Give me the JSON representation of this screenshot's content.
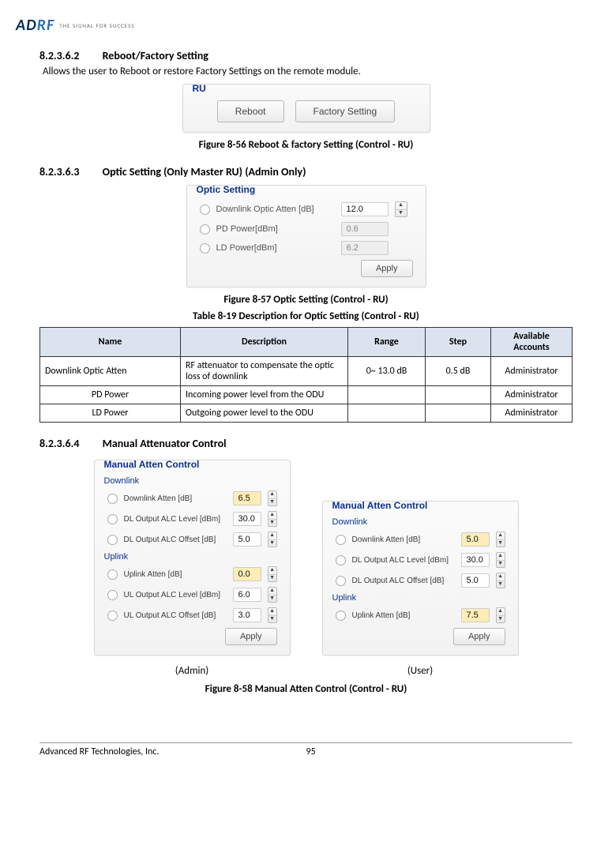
{
  "logo": {
    "brand": "ADRF",
    "tagline": "THE SIGNAL FOR SUCCESS"
  },
  "sections": {
    "reboot": {
      "num": "8.2.3.6.2",
      "title": "Reboot/Factory Setting",
      "body": "Allows the user to Reboot or restore Factory Settings on the remote module.",
      "panel_title": "RU",
      "btn_reboot": "Reboot",
      "btn_factory": "Factory Setting",
      "caption": "Figure 8-56   Reboot & factory Setting (Control - RU)"
    },
    "optic": {
      "num": "8.2.3.6.3",
      "title": "Optic Setting (Only Master RU) (Admin Only)",
      "panel_title": "Optic Setting",
      "rows": {
        "dl_label": "Downlink Optic Atten [dB]",
        "dl_val": "12.0",
        "pd_label": "PD Power[dBm]",
        "pd_val": "0.6",
        "ld_label": "LD Power[dBm]",
        "ld_val": "6.2"
      },
      "btn_apply": "Apply",
      "caption": "Figure 8-57   Optic Setting (Control - RU)"
    },
    "table": {
      "caption": "Table 8-19    Description for Optic Setting (Control - RU)",
      "headers": [
        "Name",
        "Description",
        "Range",
        "Step",
        "Available Accounts"
      ],
      "rows": [
        {
          "name": "Downlink Optic Atten",
          "desc": "RF attenuator to compensate the optic loss of downlink",
          "range": "0~ 13.0 dB",
          "step": "0.5 dB",
          "acct": "Administrator"
        },
        {
          "name": "PD Power",
          "desc": "Incoming power level from the ODU",
          "range": "",
          "step": "",
          "acct": "Administrator"
        },
        {
          "name": "LD Power",
          "desc": "Outgoing power level to the ODU",
          "range": "",
          "step": "",
          "acct": "Administrator"
        }
      ]
    },
    "manual": {
      "num": "8.2.3.6.4",
      "title": "Manual Attenuator Control",
      "panel_title": "Manual Atten Control",
      "downlink_hdr": "Downlink",
      "uplink_hdr": "Uplink",
      "admin": {
        "rows": [
          {
            "label": "Downlink Atten [dB]",
            "val": "6.5",
            "accent": true
          },
          {
            "label": "DL Output ALC Level [dBm]",
            "val": "30.0"
          },
          {
            "label": "DL Output ALC Offset [dB]",
            "val": "5.0"
          }
        ],
        "uplink_rows": [
          {
            "label": "Uplink Atten [dB]",
            "val": "0.0",
            "accent": true
          },
          {
            "label": "UL Output ALC Level [dBm]",
            "val": "6.0"
          },
          {
            "label": "UL Output ALC Offset [dB]",
            "val": "3.0"
          }
        ]
      },
      "user": {
        "rows": [
          {
            "label": "Downlink Atten [dB]",
            "val": "5.0",
            "accent": true
          },
          {
            "label": "DL Output ALC Level [dBm]",
            "val": "30.0"
          },
          {
            "label": "DL Output ALC Offset [dB]",
            "val": "5.0"
          }
        ],
        "uplink_rows": [
          {
            "label": "Uplink Atten [dB]",
            "val": "7.5",
            "accent": true
          }
        ]
      },
      "btn_apply": "Apply",
      "role_admin": "(Admin)",
      "role_user": "(User)",
      "caption": "Figure 8-58   Manual Atten Control (Control - RU)"
    }
  },
  "footer": {
    "company": "Advanced RF Technologies, Inc.",
    "page": "95"
  }
}
